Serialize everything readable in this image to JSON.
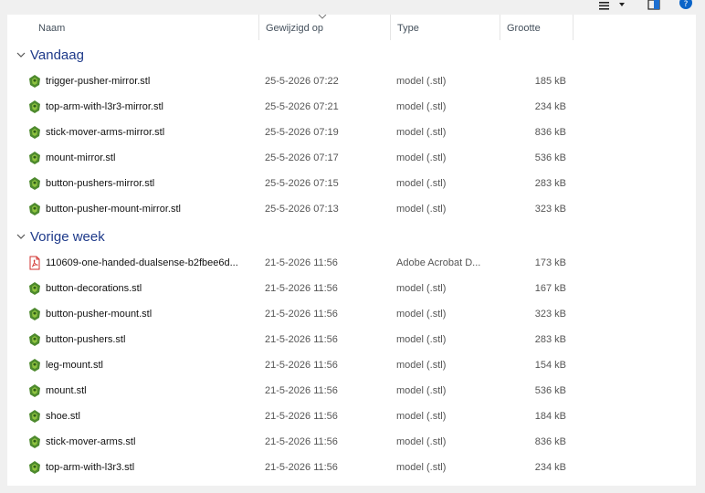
{
  "columns": {
    "name": "Naam",
    "date": "Gewijzigd op",
    "type": "Type",
    "size": "Grootte"
  },
  "groups": [
    {
      "label": "Vandaag",
      "files": [
        {
          "name": "trigger-pusher-mirror.stl",
          "date": "25-5-2026 07:22",
          "type": "model (.stl)",
          "size": "185 kB",
          "icon": "stl-file-icon"
        },
        {
          "name": "top-arm-with-l3r3-mirror.stl",
          "date": "25-5-2026 07:21",
          "type": "model (.stl)",
          "size": "234 kB",
          "icon": "stl-file-icon"
        },
        {
          "name": "stick-mover-arms-mirror.stl",
          "date": "25-5-2026 07:19",
          "type": "model (.stl)",
          "size": "836 kB",
          "icon": "stl-file-icon"
        },
        {
          "name": "mount-mirror.stl",
          "date": "25-5-2026 07:17",
          "type": "model (.stl)",
          "size": "536 kB",
          "icon": "stl-file-icon"
        },
        {
          "name": "button-pushers-mirror.stl",
          "date": "25-5-2026 07:15",
          "type": "model (.stl)",
          "size": "283 kB",
          "icon": "stl-file-icon"
        },
        {
          "name": "button-pusher-mount-mirror.stl",
          "date": "25-5-2026 07:13",
          "type": "model (.stl)",
          "size": "323 kB",
          "icon": "stl-file-icon"
        }
      ]
    },
    {
      "label": "Vorige week",
      "files": [
        {
          "name": "110609-one-handed-dualsense-b2fbee6d...",
          "date": "21-5-2026 11:56",
          "type": "Adobe Acrobat D...",
          "size": "173 kB",
          "icon": "pdf-file-icon"
        },
        {
          "name": "button-decorations.stl",
          "date": "21-5-2026 11:56",
          "type": "model (.stl)",
          "size": "167 kB",
          "icon": "stl-file-icon"
        },
        {
          "name": "button-pusher-mount.stl",
          "date": "21-5-2026 11:56",
          "type": "model (.stl)",
          "size": "323 kB",
          "icon": "stl-file-icon"
        },
        {
          "name": "button-pushers.stl",
          "date": "21-5-2026 11:56",
          "type": "model (.stl)",
          "size": "283 kB",
          "icon": "stl-file-icon"
        },
        {
          "name": "leg-mount.stl",
          "date": "21-5-2026 11:56",
          "type": "model (.stl)",
          "size": "154 kB",
          "icon": "stl-file-icon"
        },
        {
          "name": "mount.stl",
          "date": "21-5-2026 11:56",
          "type": "model (.stl)",
          "size": "536 kB",
          "icon": "stl-file-icon"
        },
        {
          "name": "shoe.stl",
          "date": "21-5-2026 11:56",
          "type": "model (.stl)",
          "size": "184 kB",
          "icon": "stl-file-icon"
        },
        {
          "name": "stick-mover-arms.stl",
          "date": "21-5-2026 11:56",
          "type": "model (.stl)",
          "size": "836 kB",
          "icon": "stl-file-icon"
        },
        {
          "name": "top-arm-with-l3r3.stl",
          "date": "21-5-2026 11:56",
          "type": "model (.stl)",
          "size": "234 kB",
          "icon": "stl-file-icon"
        }
      ]
    }
  ],
  "colors": {
    "group_heading": "#1e3a8a",
    "stl_icon": "#4e8a2e",
    "pdf_icon": "#d0312d",
    "accent": "#0a64c8"
  },
  "toolbar_icons": [
    "view-options-icon",
    "details-pane-icon",
    "help-icon"
  ]
}
